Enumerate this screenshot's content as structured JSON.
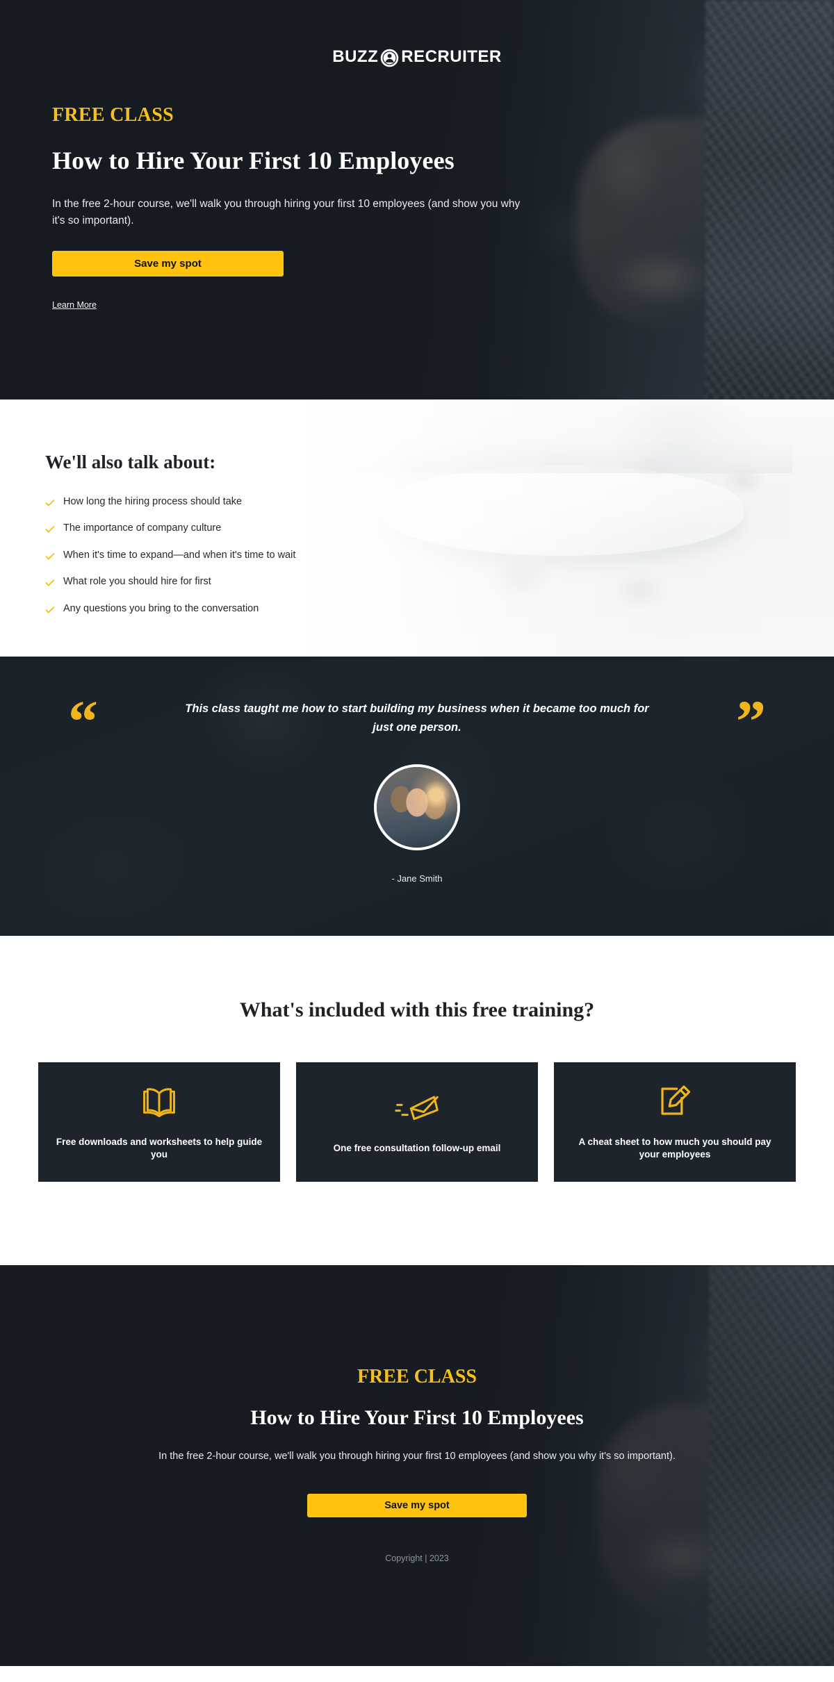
{
  "brand": {
    "word_left": "BUZZ",
    "word_right": "RECRUITER",
    "mark_icon": "person-in-circle-icon"
  },
  "hero": {
    "eyebrow": "FREE CLASS",
    "title": "How to Hire Your First 10 Employees",
    "subtitle": "In the free 2-hour course, we'll walk you through hiring your first 10 employees (and show you why it's so important).",
    "cta_label": "Save my spot",
    "learn_more_label": "Learn More"
  },
  "talk_about": {
    "title": "We'll also talk about:",
    "items": [
      "How long the hiring process should take",
      "The importance of company culture",
      "When it's time to expand—and when it's time to wait",
      "What role you should hire for first",
      "Any questions you bring to the conversation"
    ]
  },
  "testimonial": {
    "open_quote": "“",
    "close_quote": "”",
    "text": "This class taught me how to start building my business when it became too much for just one person.",
    "author": "- Jane Smith"
  },
  "included": {
    "title": "What's included with this free training?",
    "cards": [
      {
        "icon": "open-book-icon",
        "label": "Free downloads and worksheets to help guide you"
      },
      {
        "icon": "flying-envelope-icon",
        "label": "One free consultation follow-up email"
      },
      {
        "icon": "document-pencil-icon",
        "label": "A cheat sheet to how much you should pay your employees"
      }
    ]
  },
  "footer_cta": {
    "eyebrow": "FREE CLASS",
    "title": "How to Hire Your First 10 Employees",
    "subtitle": "In the free 2-hour course, we'll walk you through hiring your first 10 employees (and show you why it's so important).",
    "cta_label": "Save my spot",
    "copyright": "Copyright  |  2023"
  },
  "colors": {
    "accent_yellow": "#ffc20e",
    "eyebrow_yellow": "#f5c01f",
    "dark_navy": "#1b2026",
    "card_navy": "#1d242b",
    "quote_navy": "#222a31"
  }
}
